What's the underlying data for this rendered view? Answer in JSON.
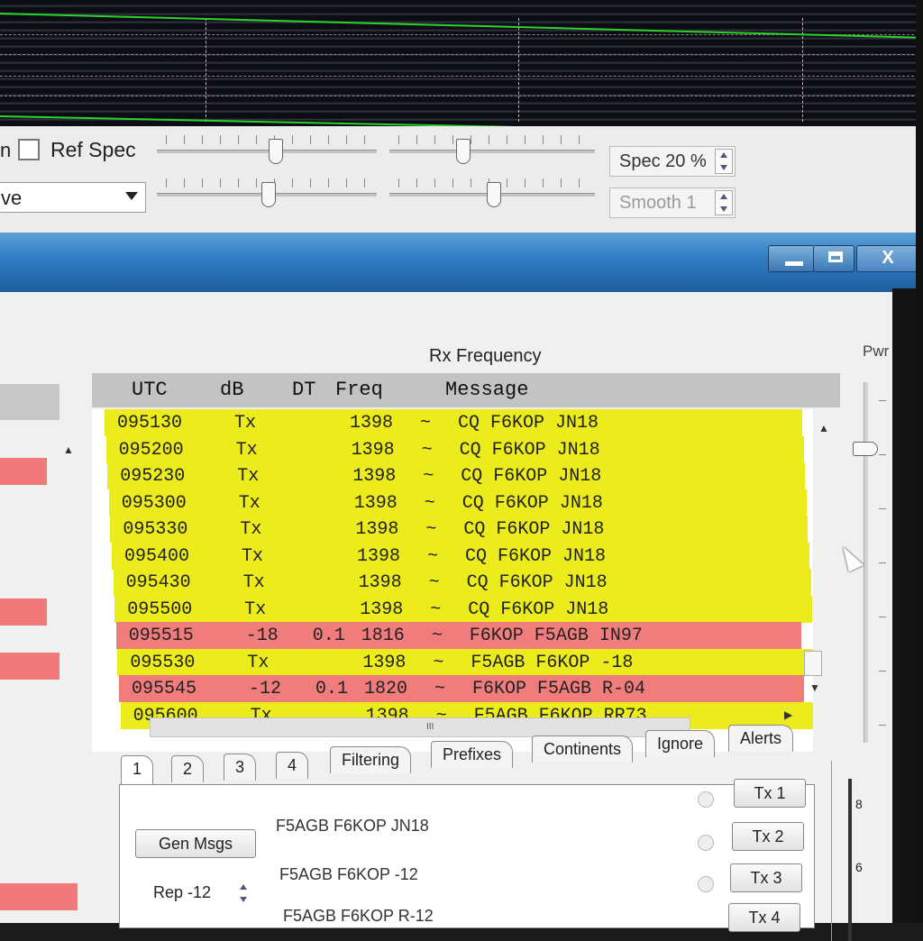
{
  "controls": {
    "cut_label": "n",
    "ref_spec_label": "Ref Spec",
    "mode_value": "ve",
    "spec_value": "Spec 20 %",
    "smooth_value": "Smooth  1"
  },
  "window": {
    "min_glyph": "",
    "max_glyph": "",
    "close_glyph": "X"
  },
  "rx_panel": {
    "title": "Rx Frequency",
    "columns": {
      "utc": "UTC",
      "db": "dB",
      "dt": "DT",
      "freq": "Freq",
      "message": "Message"
    },
    "rows": [
      {
        "utc": "095130",
        "db": "Tx",
        "dt": "",
        "freq": "1398",
        "sep": "~",
        "message": "CQ F6KOP JN18",
        "kind": "tx"
      },
      {
        "utc": "095200",
        "db": "Tx",
        "dt": "",
        "freq": "1398",
        "sep": "~",
        "message": "CQ F6KOP JN18",
        "kind": "tx"
      },
      {
        "utc": "095230",
        "db": "Tx",
        "dt": "",
        "freq": "1398",
        "sep": "~",
        "message": "CQ F6KOP JN18",
        "kind": "tx"
      },
      {
        "utc": "095300",
        "db": "Tx",
        "dt": "",
        "freq": "1398",
        "sep": "~",
        "message": "CQ F6KOP JN18",
        "kind": "tx"
      },
      {
        "utc": "095330",
        "db": "Tx",
        "dt": "",
        "freq": "1398",
        "sep": "~",
        "message": "CQ F6KOP JN18",
        "kind": "tx"
      },
      {
        "utc": "095400",
        "db": "Tx",
        "dt": "",
        "freq": "1398",
        "sep": "~",
        "message": "CQ F6KOP JN18",
        "kind": "tx"
      },
      {
        "utc": "095430",
        "db": "Tx",
        "dt": "",
        "freq": "1398",
        "sep": "~",
        "message": "CQ F6KOP JN18",
        "kind": "tx"
      },
      {
        "utc": "095500",
        "db": "Tx",
        "dt": "",
        "freq": "1398",
        "sep": "~",
        "message": "CQ F6KOP JN18",
        "kind": "tx"
      },
      {
        "utc": "095515",
        "db": "-18",
        "dt": "0.1",
        "freq": "1816",
        "sep": "~",
        "message": "F6KOP F5AGB IN97",
        "kind": "rx"
      },
      {
        "utc": "095530",
        "db": "Tx",
        "dt": "",
        "freq": "1398",
        "sep": "~",
        "message": "F5AGB F6KOP -18",
        "kind": "tx"
      },
      {
        "utc": "095545",
        "db": "-12",
        "dt": "0.1",
        "freq": "1820",
        "sep": "~",
        "message": "F6KOP F5AGB R-04",
        "kind": "rx"
      },
      {
        "utc": "095600",
        "db": "Tx",
        "dt": "",
        "freq": "1398",
        "sep": "~",
        "message": "F5AGB F6KOP RR73",
        "kind": "tx"
      }
    ],
    "hscroll_grip": "III"
  },
  "power": {
    "label": "Pwr"
  },
  "tabs": [
    "1",
    "2",
    "3",
    "4",
    "Filtering",
    "Prefixes",
    "Continents",
    "Ignore",
    "Alerts"
  ],
  "tab1": {
    "gen_msgs_label": "Gen Msgs",
    "rep_value": "Rep -12",
    "messages": [
      "F5AGB F6KOP JN18",
      "F5AGB F6KOP -12",
      "F5AGB F6KOP R-12"
    ],
    "tx_buttons": [
      "Tx 1",
      "Tx 2",
      "Tx 3",
      "Tx 4"
    ]
  },
  "meter": {
    "labels": [
      "8",
      "6"
    ]
  },
  "colors": {
    "tx_row": "#ecec1c",
    "rx_row": "#f07c7c",
    "titlebar": "#2f7bc2"
  }
}
